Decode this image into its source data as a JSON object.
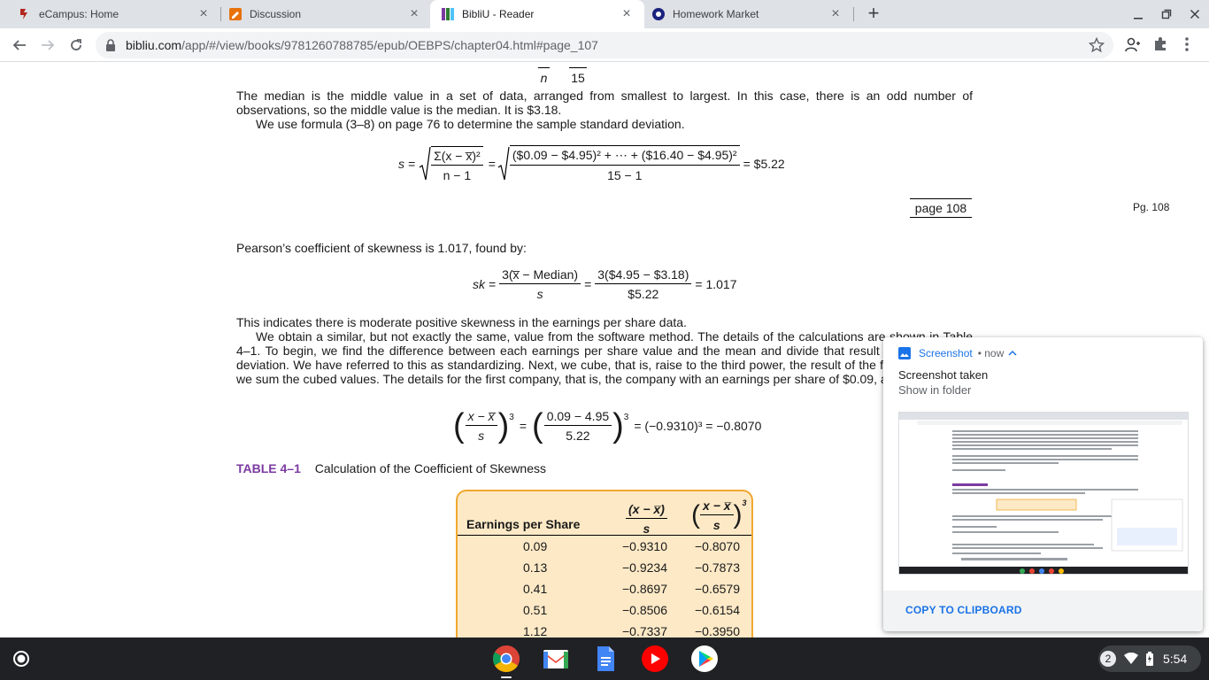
{
  "browser": {
    "tabs": [
      {
        "title": "eCampus: Home",
        "favicon": "ecampus-icon"
      },
      {
        "title": "Discussion",
        "favicon": "discussion-icon"
      },
      {
        "title": "BibliU - Reader",
        "favicon": "bibliu-icon",
        "active": true
      },
      {
        "title": "Homework Market",
        "favicon": "homework-market-icon"
      }
    ],
    "url_host": "bibliu.com",
    "url_path": "/app/#/view/books/9781260788785/epub/OEBPS/chapter04.html#page_107"
  },
  "reader": {
    "top_eq_n": "n",
    "top_eq_15": "15",
    "para_median": "The median is the middle value in a set of data, arranged from smallest to largest. In this case, there is an odd number of observations, so the middle value is the median. It is $3.18.",
    "para_formula": "We use formula (3–8) on page 76 to determine the sample standard deviation.",
    "sd_eq": {
      "lhs": "s =",
      "num1": "Σ(x − x̅)²",
      "den1": "n − 1",
      "num2": "($0.09 − $4.95)² + ⋯ + ($16.40 − $4.95)²",
      "den2": "15 − 1",
      "result": "= $5.22"
    },
    "page_marker": "page 108",
    "page_label": "Pg. 108",
    "para_pearson": "Pearson’s coefficient of skewness is 1.017, found by:",
    "sk_eq": {
      "lhs": "sk =",
      "num1": "3(x̅ − Median)",
      "den1": "s",
      "num2": "3($4.95 − $3.18)",
      "den2": "$5.22",
      "result": "= 1.017"
    },
    "para_indicates": "This indicates there is moderate positive skewness in the earnings per share data.",
    "para_software": "We obtain a similar, but not exactly the same, value from the software method. The details of the calculations are shown in Table 4–1. To begin, we find the difference between each earnings per share value and the mean and divide that result by the standard deviation. We have referred to this as standardizing. Next, we cube, that is, raise to the third power, the result of the first step. Finally, we sum the cubed values. The details for the first company, that is, the company with an earnings per share of $0.09, are:",
    "cube_eq": {
      "num1": "x − x̅",
      "den1": "s",
      "num2": "0.09 − 4.95",
      "den2": "5.22",
      "result": "= (−0.9310)³ = −0.8070"
    },
    "table_number": "TABLE 4–1",
    "table_title": "Calculation of the Coefficient of Skewness",
    "table": {
      "col1": "Earnings per Share",
      "col2_num": "(x − x̅)",
      "col2_den": "s",
      "col3_num": "x − x̅",
      "col3_den": "s",
      "rows": [
        [
          "0.09",
          "−0.9310",
          "−0.8070"
        ],
        [
          "0.13",
          "−0.9234",
          "−0.7873"
        ],
        [
          "0.41",
          "−0.8697",
          "−0.6579"
        ],
        [
          "0.51",
          "−0.8506",
          "−0.6154"
        ],
        [
          "1.12",
          "−0.7337",
          "−0.3950"
        ]
      ]
    }
  },
  "notification": {
    "app": "Screenshot",
    "when": "now",
    "title": "Screenshot taken",
    "subtitle": "Show in folder",
    "action": "COPY TO CLIPBOARD"
  },
  "shelf": {
    "apps": [
      "chrome-icon",
      "gmail-icon",
      "docs-icon",
      "youtube-icon",
      "play-store-icon"
    ],
    "notification_count": "2",
    "time": "5:54"
  }
}
